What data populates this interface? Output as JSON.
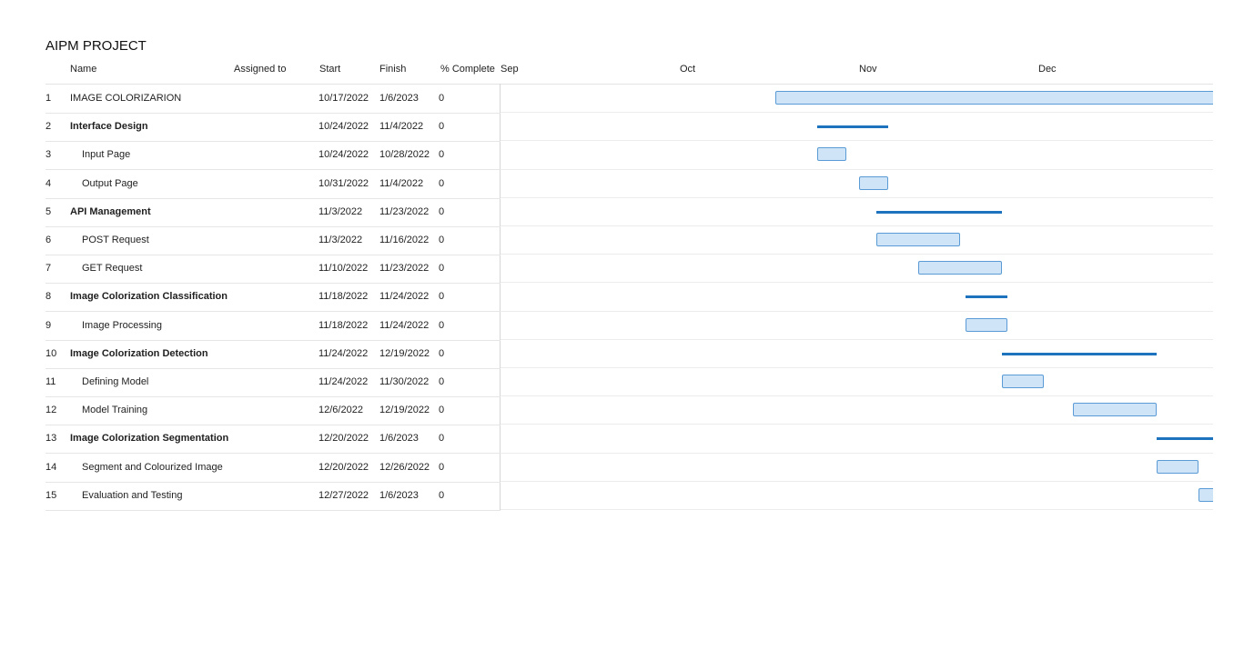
{
  "project": {
    "title": "AIPM PROJECT"
  },
  "columns": {
    "name": "Name",
    "assigned": "Assigned to",
    "start": "Start",
    "finish": "Finish",
    "pct": "% Complete"
  },
  "timeline": {
    "months": [
      "Sep",
      "Oct",
      "Nov",
      "Dec"
    ]
  },
  "colors": {
    "task_fill": "#cfe5f7",
    "task_border": "#5b9bd5",
    "summary": "#1e73be"
  },
  "tasks": [
    {
      "id": "1",
      "name": "IMAGE COLORIZARION",
      "start": "10/17/2022",
      "finish": "1/6/2023",
      "pct": "0",
      "summary": false,
      "indent": false
    },
    {
      "id": "2",
      "name": "Interface Design",
      "start": "10/24/2022",
      "finish": "11/4/2022",
      "pct": "0",
      "summary": true,
      "indent": false
    },
    {
      "id": "3",
      "name": "Input Page",
      "start": "10/24/2022",
      "finish": "10/28/2022",
      "pct": "0",
      "summary": false,
      "indent": true
    },
    {
      "id": "4",
      "name": "Output Page",
      "start": "10/31/2022",
      "finish": "11/4/2022",
      "pct": "0",
      "summary": false,
      "indent": true
    },
    {
      "id": "5",
      "name": "API Management",
      "start": "11/3/2022",
      "finish": "11/23/2022",
      "pct": "0",
      "summary": true,
      "indent": false
    },
    {
      "id": "6",
      "name": "POST Request",
      "start": "11/3/2022",
      "finish": "11/16/2022",
      "pct": "0",
      "summary": false,
      "indent": true
    },
    {
      "id": "7",
      "name": "GET Request",
      "start": "11/10/2022",
      "finish": "11/23/2022",
      "pct": "0",
      "summary": false,
      "indent": true
    },
    {
      "id": "8",
      "name": "Image Colorization Classification",
      "start": "11/18/2022",
      "finish": "11/24/2022",
      "pct": "0",
      "summary": true,
      "indent": false
    },
    {
      "id": "9",
      "name": "Image Processing",
      "start": "11/18/2022",
      "finish": "11/24/2022",
      "pct": "0",
      "summary": false,
      "indent": true
    },
    {
      "id": "10",
      "name": "Image Colorization Detection",
      "start": "11/24/2022",
      "finish": "12/19/2022",
      "pct": "0",
      "summary": true,
      "indent": false
    },
    {
      "id": "11",
      "name": "Defining Model",
      "start": "11/24/2022",
      "finish": "11/30/2022",
      "pct": "0",
      "summary": false,
      "indent": true
    },
    {
      "id": "12",
      "name": "Model Training",
      "start": "12/6/2022",
      "finish": "12/19/2022",
      "pct": "0",
      "summary": false,
      "indent": true
    },
    {
      "id": "13",
      "name": "Image Colorization Segmentation",
      "start": "12/20/2022",
      "finish": "1/6/2023",
      "pct": "0",
      "summary": true,
      "indent": false
    },
    {
      "id": "14",
      "name": "Segment and Colourized Image",
      "start": "12/20/2022",
      "finish": "12/26/2022",
      "pct": "0",
      "summary": false,
      "indent": true
    },
    {
      "id": "15",
      "name": "Evaluation and Testing",
      "start": "12/27/2022",
      "finish": "1/6/2023",
      "pct": "0",
      "summary": false,
      "indent": true
    }
  ]
}
